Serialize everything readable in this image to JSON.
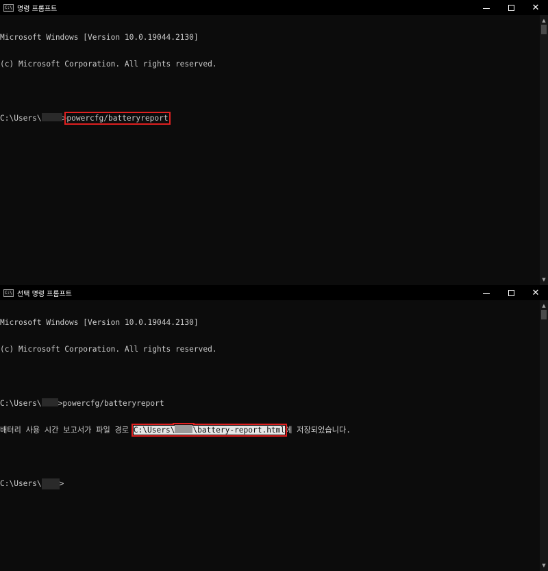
{
  "windows": [
    {
      "title": "명령 프롬프트",
      "icon": "cmd-icon",
      "controls": {
        "minimize": "—",
        "maximize": "□",
        "close": "✕"
      },
      "lines": {
        "line1": "Microsoft Windows [Version 10.0.19044.2130]",
        "line2": "(c) Microsoft Corporation. All rights reserved.",
        "prompt_prefix": "C:\\Users\\",
        "prompt_suffix": ">",
        "command": "powercfg/batteryreport"
      }
    },
    {
      "title": "선택 명령 프롬프트",
      "icon": "cmd-icon",
      "controls": {
        "minimize": "—",
        "maximize": "□",
        "close": "✕"
      },
      "lines": {
        "line1": "Microsoft Windows [Version 10.0.19044.2130]",
        "line2": "(c) Microsoft Corporation. All rights reserved.",
        "prompt_prefix": "C:\\Users\\",
        "prompt_suffix": ">",
        "command": "powercfg/batteryreport",
        "result_prefix": "배터리 사용 시간 보고서가 파일 경로 ",
        "path_prefix": "C:\\Users\\",
        "path_suffix": "\\battery-report.html",
        "result_suffix": "에 저장되었습니다.",
        "prompt2_prefix": "C:\\Users\\",
        "prompt2_suffix": ">"
      }
    }
  ],
  "colors": {
    "background": "#0c0c0c",
    "text": "#cccccc",
    "highlight_border": "#e02020",
    "selection_bg": "#e6e6e6"
  }
}
